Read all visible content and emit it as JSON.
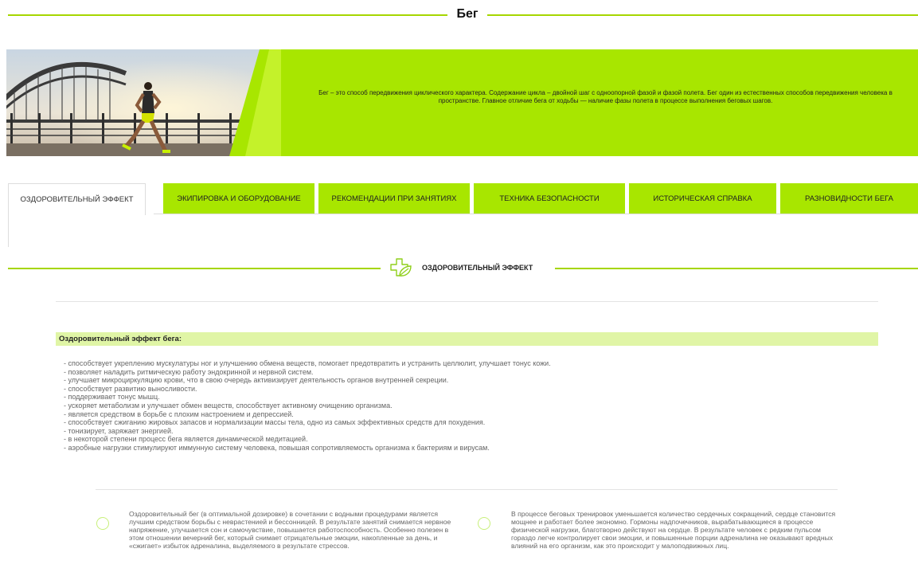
{
  "header": {
    "title": "Бег"
  },
  "banner": {
    "text": "Бег – это способ передвижения циклического характера. Содержание цикла – двойной шаг с одноопорной фазой и фазой полета. Бег один из естественных способов передвижения человека в пространстве. Главное отличие бега от ходьбы — наличие фазы полета в процессе выполнения беговых шагов."
  },
  "tabs": [
    {
      "label": "Оздоровительный эффект",
      "active": true
    },
    {
      "label": "Экипировка и оборудование",
      "active": false
    },
    {
      "label": "Рекомендации при занятиях",
      "active": false
    },
    {
      "label": "Техника безопасности",
      "active": false
    },
    {
      "label": "Историческая справка",
      "active": false
    },
    {
      "label": "Разновидности бега",
      "active": false
    }
  ],
  "section": {
    "title": "ОЗДОРОВИТЕЛЬНЫЙ ЭФФЕКТ",
    "icon": "health-plus-leaf-icon"
  },
  "effect": {
    "heading": "Оздоровительный эффект бега:",
    "items": [
      "- способствует укреплению мускулатуры ног и улучшению обмена веществ, помогает предотвратить и устранить целлюлит, улучшает тонус кожи.",
      "- позволяет наладить ритмическую работу эндокринной и нервной систем.",
      "- улучшает микроциркуляцию крови, что в свою очередь активизирует деятельность органов внутренней секреции.",
      "- способствует развитию выносливости.",
      "- поддерживает тонус мышц.",
      "- ускоряет метаболизм и улучшает обмен веществ, способствует активному очищению организма.",
      "- является средством в борьбе с плохим настроением и депрессией.",
      "- способствует сжиганию жировых запасов и нормализации массы тела, одно из самых эффективных средств для похудения.",
      "- тонизирует, заряжает энергией.",
      "- в некоторой степени процесс бега является динамической медитацией.",
      "- аэробные нагрузки стимулируют иммунную систему человека, повышая сопротивляемость организма к бактериям и вирусам."
    ]
  },
  "cards": [
    {
      "text": "Оздоровительный бег (в оптимальной дозировке) в сочетании с водными процедурами является лучшим средством борьбы с неврастенией и бессонницей. В результате занятий снимается нервное напряжение, улучшается сон и самочувствие, повышается работоспособность. Особенно полезен в этом отношении вечерний бег, который снимает отрицательные эмоции, накопленные за день, и «сжигает» избыток адреналина, выделяемого в результате стрессов."
    },
    {
      "text": "В процессе беговых тренировок уменьшается количество сердечных сокращений, сердце становится мощнее и работает более экономно. Гормоны надпочечников, вырабатывающиеся в процессе физической нагрузки, благотворно действуют на сердце. В результате человек с редким пульсом гораздо легче контролирует свои эмоции, и повышенные порции адреналина не оказывают вредных влияний на его организм, как это происходит у малоподвижных лиц."
    }
  ],
  "colors": {
    "accent": "#a8e600",
    "accent_light": "#e0f5a6",
    "line": "#a6d600"
  }
}
